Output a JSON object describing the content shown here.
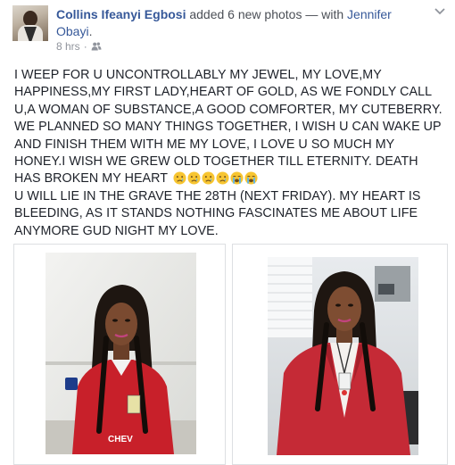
{
  "header": {
    "author": "Collins Ifeanyi Egbosi",
    "action": " added 6 new photos — with ",
    "tagged": "Jennifer Obayi",
    "period": ".",
    "time": "8 hrs",
    "separator": "·",
    "audience_icon": "friends-icon",
    "menu_icon": "chevron-down-icon"
  },
  "post": {
    "paragraph1": "I WEEP FOR U UNCONTROLLABLY MY JEWEL, MY LOVE,MY HAPPINESS,MY FIRST LADY,HEART OF GOLD, AS WE FONDLY CALL U,A WOMAN OF SUBSTANCE,A GOOD COMFORTER, MY CUTEBERRY. WE PLANNED SO MANY THINGS TOGETHER, I WISH U CAN WAKE UP AND FINISH THEM WITH ME MY LOVE, I LOVE U SO MUCH MY HONEY.I WISH WE GREW OLD TOGETHER TILL ETERNITY. DEATH HAS BROKEN MY HEART",
    "emojis": [
      "crying-face-emoji",
      "crying-face-emoji",
      "crying-face-emoji",
      "crying-face-emoji",
      "loudly-crying-face-emoji",
      "loudly-crying-face-emoji"
    ],
    "paragraph2": "U WILL LIE IN THE GRAVE THE 28TH (NEXT FRIDAY). MY HEART IS BLEEDING, AS IT STANDS NOTHING FASCINATES ME ABOUT LIFE ANYMORE GUD NIGHT MY LOVE."
  },
  "photos": [
    {
      "name": "photo-1",
      "subject": "woman in red jersey with braids"
    },
    {
      "name": "photo-2",
      "subject": "woman in red blazer with braids"
    }
  ],
  "colors": {
    "link": "#365899",
    "meta": "#90949c",
    "text": "#1d2129",
    "border": "#dddfe2"
  }
}
